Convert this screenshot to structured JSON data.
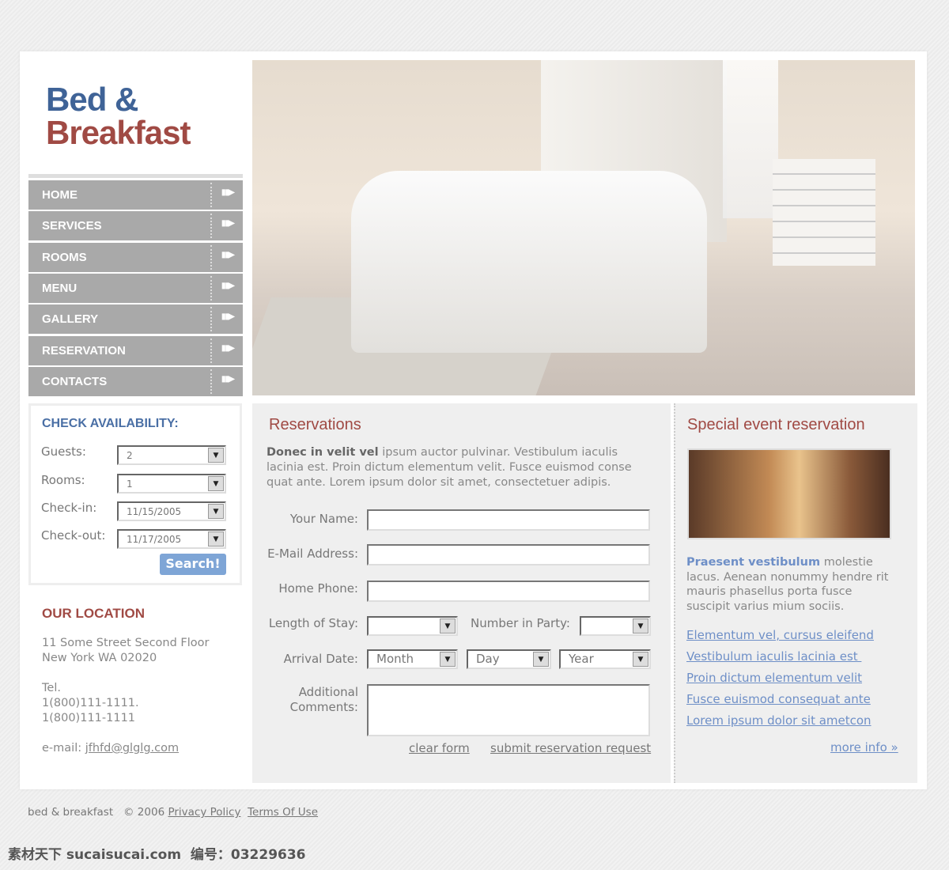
{
  "logo": {
    "line1": "Bed &",
    "line2": "Breakfast"
  },
  "nav": [
    {
      "label": "HOME"
    },
    {
      "label": "SERVICES"
    },
    {
      "label": "ROOMS"
    },
    {
      "label": "MENU"
    },
    {
      "label": "GALLERY"
    },
    {
      "label": "RESERVATION"
    },
    {
      "label": "CONTACTS"
    }
  ],
  "nav_arrow": "▮▮▶",
  "availability": {
    "title": "CHECK AVAILABILITY:",
    "fields": [
      {
        "label": "Guests:",
        "value": "2"
      },
      {
        "label": "Rooms:",
        "value": "1"
      },
      {
        "label": "Check-in:",
        "value": "11/15/2005"
      },
      {
        "label": "Check-out:",
        "value": "11/17/2005"
      }
    ],
    "button": "Search!"
  },
  "location": {
    "title": "OUR LOCATION",
    "address1": "11 Some Street Second Floor",
    "address2": "New York WA 02020",
    "tel_label": "Tel.",
    "tel1": "1(800)111-1111.",
    "tel2": "1(800)111-1111",
    "email_label": "e-mail:",
    "email": "jfhfd@glglg.com"
  },
  "reservations": {
    "title": "Reservations",
    "intro_bold": "Donec in velit vel",
    "intro": " ipsum auctor pulvinar. Vestibulum iaculis lacinia est. Proin dictum elementum velit. Fusce euismod conse quat ante. Lorem ipsum dolor sit amet, consectetuer adipis.",
    "name_label": "Your Name:",
    "email_label": "E-Mail Address:",
    "phone_label": "Home Phone:",
    "stay_label": "Length of Stay:",
    "party_label": "Number in Party:",
    "arrival_label": "Arrival Date:",
    "month": "Month",
    "day": "Day",
    "year": "Year",
    "comments_label1": "Additional",
    "comments_label2": "Comments:",
    "clear": "clear form",
    "submit": "submit reservation request"
  },
  "special": {
    "title": "Special event reservation",
    "intro_bold": "Praesent vestibulum",
    "intro": " molestie lacus. Aenean nonummy hendre rit mauris phasellus porta fusce suscipit varius mium sociis.",
    "links": [
      "Elementum vel, cursus eleifend",
      "Vestibulum iaculis lacinia est ",
      "Proin dictum elementum velit",
      "Fusce euismod consequat ante",
      "Lorem ipsum dolor sit ametcon"
    ],
    "more": "more info »"
  },
  "footer": {
    "brand": "bed & breakfast",
    "copyright": "© 2006",
    "privacy": "Privacy Policy",
    "terms": "Terms Of Use"
  },
  "watermark": "素材天下 sucaisucai.com  编号：03229636",
  "colors": {
    "blue": "#3f6397",
    "red": "#a04a44",
    "nav": "#a9a9a9",
    "link": "#6e8fc7"
  }
}
